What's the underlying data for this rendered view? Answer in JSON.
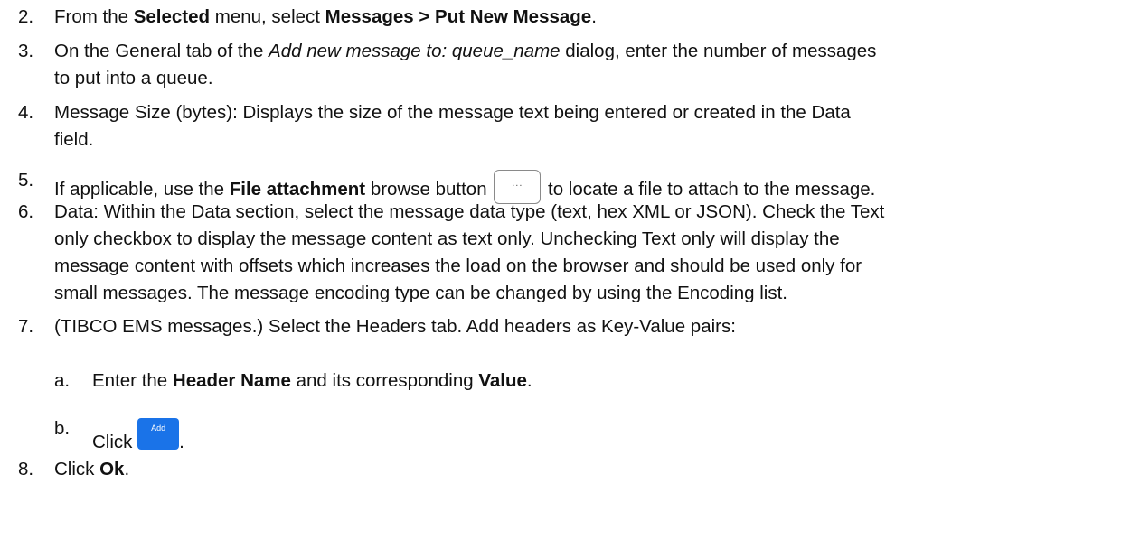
{
  "steps": [
    {
      "num": "2.",
      "t1": "From the ",
      "b1": "Selected",
      "t2": " menu, select ",
      "b2": "Messages > Put New Message",
      "t3": "."
    },
    {
      "num": "3.",
      "t1": "On the General tab of the ",
      "i1": "Add new message to: queue_name",
      "t2": " dialog, enter the number of messages",
      "l2": "to put into a queue."
    },
    {
      "num": "4.",
      "l1": "Message Size (bytes): Displays the size of the message text being entered or created in the Data",
      "l2": "field."
    },
    {
      "num": "5.",
      "t1": "If applicable, use the ",
      "b1": "File attachment",
      "t2": " browse button ",
      "btn": "...",
      "t3": " to locate a file to attach to the message."
    },
    {
      "num": "6.",
      "l1": "Data:  Within the Data section, select the message data type (text, hex XML or JSON). Check the Text",
      "l2": "only checkbox to display the message content as text only.  Unchecking Text only will display the",
      "l3": "message content with offsets which increases the load on the browser and should be used only for",
      "l4": "small messages. The message encoding type can be changed by using the Encoding list."
    },
    {
      "num": "7.",
      "l1": "(TIBCO EMS messages.) Select the Headers tab. Add headers as Key-Value pairs:"
    },
    {
      "num": "a.",
      "t1": "Enter the ",
      "b1": "Header Name",
      "t2": " and its corresponding ",
      "b2": "Value",
      "t3": "."
    },
    {
      "num": "b.",
      "t1": "Click ",
      "btn": "Add",
      "t2": "."
    },
    {
      "num": "8.",
      "t1": "Click ",
      "b1": "Ok",
      "t2": "."
    }
  ],
  "colors": {
    "add_button": "#1a73e8"
  }
}
